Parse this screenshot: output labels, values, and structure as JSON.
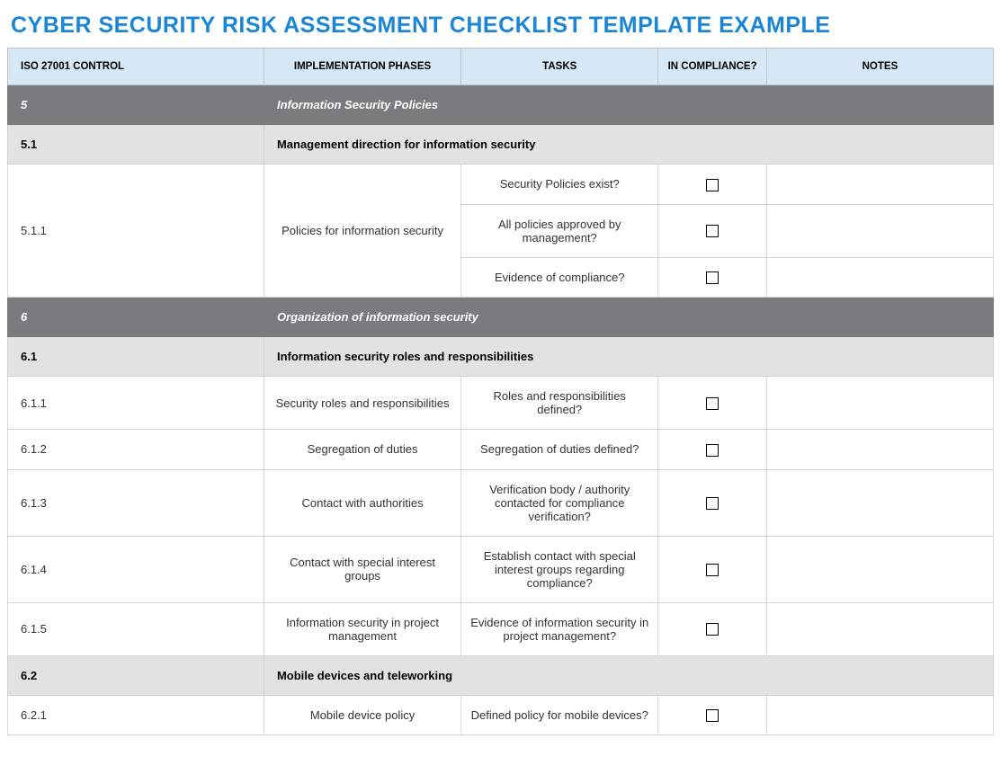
{
  "title": "CYBER SECURITY RISK ASSESSMENT CHECKLIST TEMPLATE EXAMPLE",
  "headers": {
    "control": "ISO 27001 CONTROL",
    "phases": "IMPLEMENTATION PHASES",
    "tasks": "TASKS",
    "compliance": "IN COMPLIANCE?",
    "notes": "NOTES"
  },
  "sections": [
    {
      "num": "5",
      "title": "Information Security Policies",
      "subsections": [
        {
          "num": "5.1",
          "title": "Management direction for information security",
          "rows": [
            {
              "num": "5.1.1",
              "phase": "Policies for information security",
              "tasks": [
                "Security Policies exist?",
                "All policies approved by management?",
                "Evidence of compliance?"
              ]
            }
          ]
        }
      ]
    },
    {
      "num": "6",
      "title": "Organization of information security",
      "subsections": [
        {
          "num": "6.1",
          "title": "Information security roles and responsibilities",
          "rows": [
            {
              "num": "6.1.1",
              "phase": "Security roles and responsibilities",
              "tasks": [
                "Roles and responsibilities defined?"
              ]
            },
            {
              "num": "6.1.2",
              "phase": "Segregation of duties",
              "tasks": [
                "Segregation of duties defined?"
              ]
            },
            {
              "num": "6.1.3",
              "phase": "Contact with authorities",
              "tasks": [
                "Verification body / authority contacted for compliance verification?"
              ]
            },
            {
              "num": "6.1.4",
              "phase": "Contact with special interest groups",
              "tasks": [
                "Establish contact with special interest groups regarding compliance?"
              ]
            },
            {
              "num": "6.1.5",
              "phase": "Information security in project management",
              "tasks": [
                "Evidence of information security in project management?"
              ]
            }
          ]
        },
        {
          "num": "6.2",
          "title": "Mobile devices and teleworking",
          "rows": [
            {
              "num": "6.2.1",
              "phase": "Mobile device policy",
              "tasks": [
                "Defined policy for mobile devices?"
              ]
            }
          ]
        }
      ]
    }
  ]
}
